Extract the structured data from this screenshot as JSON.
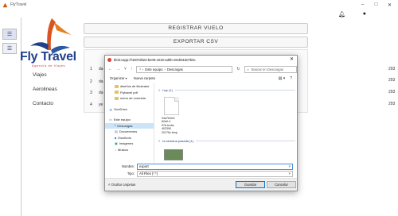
{
  "window": {
    "title": "FlyTravel",
    "controls": [
      "–",
      "□",
      "✕"
    ]
  },
  "top_icons": [
    "bell-icon",
    "user-icon"
  ],
  "brand": {
    "name": "Fly Travel",
    "tagline": "Agencia de Viajes"
  },
  "nav": {
    "items": [
      {
        "label": "Viajes"
      },
      {
        "label": "Aerolineas"
      },
      {
        "label": "Contacto"
      }
    ]
  },
  "main": {
    "register_label": "REGISTRAR VUELO",
    "export_label": "EXPORTAR CSV",
    "rows": [
      {
        "num": "1",
        "frag": "da"
      },
      {
        "num": "2",
        "frag": "da"
      },
      {
        "num": "3",
        "frag": "da"
      },
      {
        "num": "4",
        "frag": "ye"
      }
    ],
    "right_values": [
      "293",
      "293",
      "293",
      "293"
    ]
  },
  "dialog": {
    "title": "blob:capp:///4307d623-be09-4233-ad0b-e6eb91507b5c",
    "close": "✕",
    "path": [
      "Este equipo",
      "Descargas"
    ],
    "search_placeholder": "Buscar en Descargas",
    "organize_label": "Organizar ▾",
    "new_folder_label": "Nueva carpeta",
    "tree": [
      {
        "label": "diseños de illustrator",
        "level": 1,
        "type": "folder"
      },
      {
        "label": "Flytravel pdf",
        "level": 1,
        "type": "folder"
      },
      {
        "label": "menu de comnida",
        "level": 1,
        "type": "folder"
      },
      {
        "label": "OneDrive",
        "level": 0,
        "type": "cloud"
      },
      {
        "label": "Este equipo",
        "level": 0,
        "type": "pc"
      },
      {
        "label": "Descargas",
        "level": 1,
        "type": "download",
        "selected": true
      },
      {
        "label": "Documentos",
        "level": 1,
        "type": "doc"
      },
      {
        "label": "Escritorio",
        "level": 1,
        "type": "desktop"
      },
      {
        "label": "Imágenes",
        "level": 1,
        "type": "image"
      },
      {
        "label": "Música",
        "level": 1,
        "type": "music"
      }
    ],
    "group_today": "hoy (1)",
    "file_name_lines": [
      "04a7b2e9-82a0-4",
      "97b-bc4a-402390",
      "20176c.bmp"
    ],
    "group_last_week": "la semana pasada (1)",
    "filename_label": "Nombre:",
    "filename_value": "export",
    "type_label": "Tipo:",
    "type_value": "All Files (*.*)",
    "hide_folders_label": "Ocultar carpetas",
    "save_label": "Guardar",
    "cancel_label": "Cancelar"
  }
}
